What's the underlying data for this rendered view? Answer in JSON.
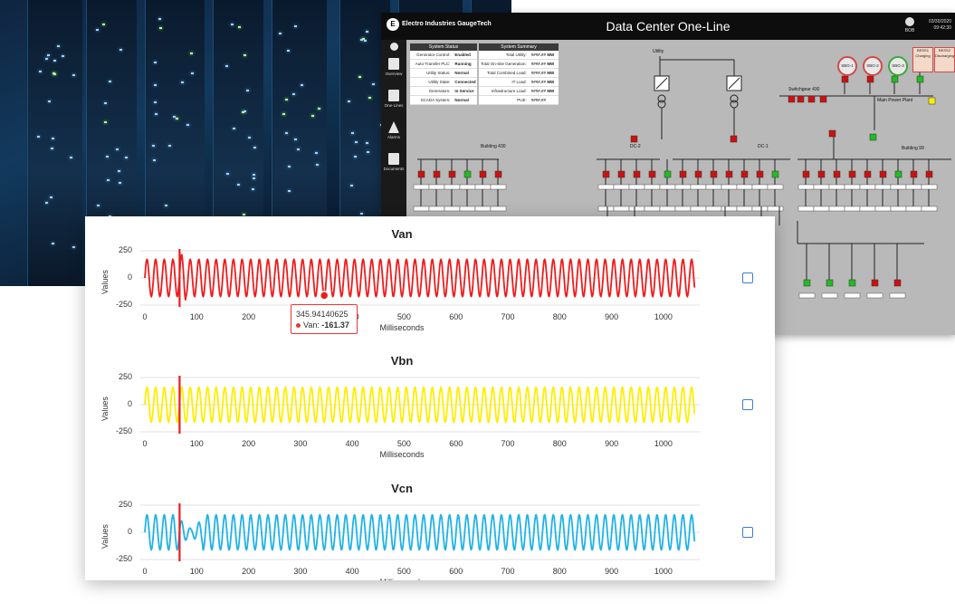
{
  "dashboard": {
    "logo_text": "Electro Industries GaugeTech",
    "title": "Data Center One-Line",
    "user": "BOB",
    "date": "03/30/2020",
    "time": "09:42:30",
    "nav": [
      "Overview",
      "One-Lines",
      "Alarms",
      "Documents"
    ],
    "status_table": {
      "header": "System Status",
      "rows": [
        {
          "key": "Generator Control:",
          "value": "Enabled"
        },
        {
          "key": "Auto-Transfer PLC:",
          "value": "Running"
        },
        {
          "key": "Utility Status:",
          "value": "Normal"
        },
        {
          "key": "Utility State:",
          "value": "Connected"
        },
        {
          "key": "Generators:",
          "value": "In Service"
        },
        {
          "key": "SCADA System:",
          "value": "Normal"
        }
      ]
    },
    "summary_table": {
      "header": "System Summary",
      "rows": [
        {
          "key": "Total Utility:",
          "value": "####.## MW"
        },
        {
          "key": "Total On-Site Generation:",
          "value": "####.## MW"
        },
        {
          "key": "Total Combined Load:",
          "value": "####.## MW"
        },
        {
          "key": "IT Load:",
          "value": "####.## MW"
        },
        {
          "key": "Infrastructure Load:",
          "value": "####.## MW"
        },
        {
          "key": "PUE:",
          "value": "####.##"
        }
      ]
    },
    "labels": {
      "utility": "Utility",
      "switchgear": "Switchgear 430",
      "main_power": "Main Power Plant",
      "building_430": "Building 430",
      "dc_2": "DC-2",
      "dc_1": "DC-1",
      "building_99": "Building 99"
    },
    "generators": [
      "SBG-1",
      "SBG-2",
      "SBG-3"
    ],
    "bess": [
      {
        "name": "BESS1",
        "state": "Charging"
      },
      {
        "name": "BESS2",
        "state": "Discharging"
      }
    ]
  },
  "channels": [
    {
      "title": "Van",
      "color": "#ee1c1c",
      "amplitude": 170,
      "transient": "spike",
      "yticks": [
        "250",
        "0",
        "-250"
      ],
      "xticks": [
        "0",
        "100",
        "200",
        "300",
        "400",
        "500",
        "600",
        "700",
        "800",
        "900",
        "1000"
      ],
      "ylabel": "Values",
      "xlabel": "Milliseconds"
    },
    {
      "title": "Vbn",
      "color": "#ffee00",
      "amplitude": 160,
      "transient": "none",
      "yticks": [
        "250",
        "0",
        "-250"
      ],
      "xticks": [
        "0",
        "100",
        "200",
        "300",
        "400",
        "500",
        "600",
        "700",
        "800",
        "900",
        "1000"
      ],
      "ylabel": "Values",
      "xlabel": "Milliseconds"
    },
    {
      "title": "Vcn",
      "color": "#1fb3e8",
      "amplitude": 160,
      "transient": "sag",
      "yticks": [
        "250",
        "0",
        "-250"
      ],
      "xticks": [
        "0",
        "100",
        "200",
        "300",
        "400",
        "500",
        "600",
        "700",
        "800",
        "900",
        "1000"
      ],
      "ylabel": "Values",
      "xlabel": "Milliseconds"
    }
  ],
  "chart_data": [
    {
      "type": "line",
      "title": "Van",
      "xlabel": "Milliseconds",
      "ylabel": "Values",
      "xlim": [
        0,
        1070
      ],
      "ylim": [
        -250,
        250
      ],
      "cycle_ms": 16.67,
      "amplitude": 170,
      "event_ms": 67
    },
    {
      "type": "line",
      "title": "Vbn",
      "xlabel": "Milliseconds",
      "ylabel": "Values",
      "xlim": [
        0,
        1070
      ],
      "ylim": [
        -250,
        250
      ],
      "cycle_ms": 16.67,
      "amplitude": 160,
      "event_ms": 67
    },
    {
      "type": "line",
      "title": "Vcn",
      "xlabel": "Milliseconds",
      "ylabel": "Values",
      "xlim": [
        0,
        1070
      ],
      "ylim": [
        -250,
        250
      ],
      "cycle_ms": 16.67,
      "amplitude": 160,
      "event_ms": 67
    }
  ],
  "tooltip": {
    "x_value": "345.94140625",
    "series": "Van:",
    "y_value": "-161.37"
  }
}
